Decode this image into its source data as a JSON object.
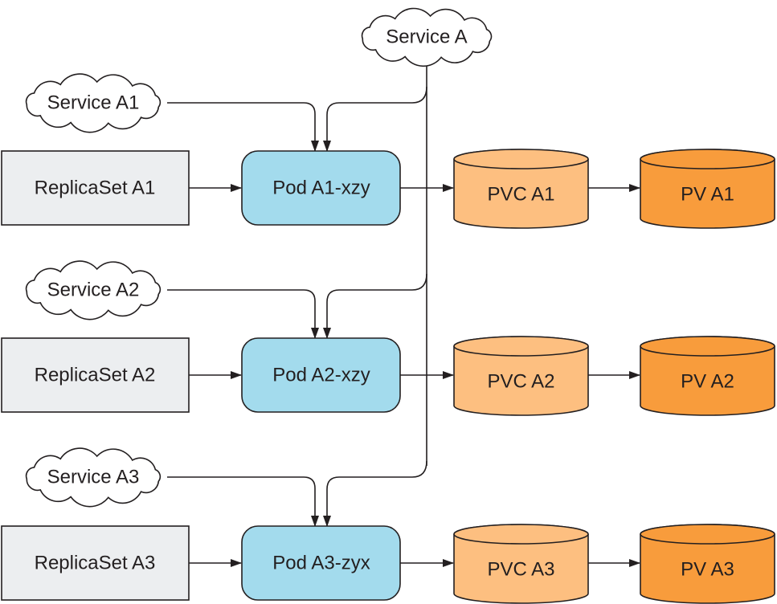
{
  "service_main": {
    "label": "Service A"
  },
  "rows": [
    {
      "service": "Service A1",
      "replicaset": "ReplicaSet A1",
      "pod": "Pod A1-xzy",
      "pvc": "PVC A1",
      "pv": "PV A1"
    },
    {
      "service": "Service A2",
      "replicaset": "ReplicaSet A2",
      "pod": "Pod A2-xzy",
      "pvc": "PVC A2",
      "pv": "PV A2"
    },
    {
      "service": "Service A3",
      "replicaset": "ReplicaSet A3",
      "pod": "Pod A3-zyx",
      "pvc": "PVC A3",
      "pv": "PV A3"
    }
  ],
  "colors": {
    "replicaset_fill": "#eceef0",
    "pod_fill": "#a3dbed",
    "pvc_fill": "#fdbf80",
    "pv_fill": "#f89c3c",
    "stroke": "#231f20"
  }
}
